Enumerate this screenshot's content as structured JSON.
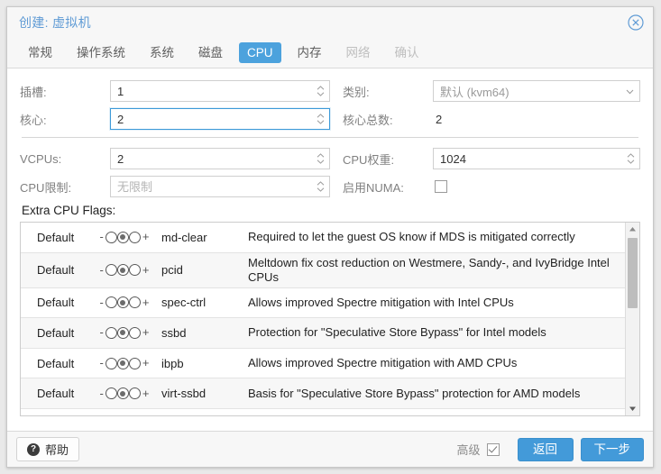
{
  "window": {
    "title": "创建: 虚拟机",
    "close_icon": "close-circle-icon"
  },
  "tabs": [
    {
      "label": "常规",
      "state": "normal"
    },
    {
      "label": "操作系统",
      "state": "normal"
    },
    {
      "label": "系统",
      "state": "normal"
    },
    {
      "label": "磁盘",
      "state": "normal"
    },
    {
      "label": "CPU",
      "state": "active"
    },
    {
      "label": "内存",
      "state": "normal"
    },
    {
      "label": "网络",
      "state": "disabled"
    },
    {
      "label": "确认",
      "state": "disabled"
    }
  ],
  "form": {
    "sockets": {
      "label": "插槽:",
      "value": "1"
    },
    "type": {
      "label": "类别:",
      "value": "默认 (kvm64)"
    },
    "cores": {
      "label": "核心:",
      "value": "2",
      "focused": true
    },
    "total_cores": {
      "label": "核心总数:",
      "value": "2"
    },
    "vcpus": {
      "label": "VCPUs:",
      "value": "2"
    },
    "cpu_weight": {
      "label": "CPU权重:",
      "value": "1024"
    },
    "cpu_limit": {
      "label": "CPU限制:",
      "value": "",
      "placeholder": "无限制"
    },
    "enable_numa": {
      "label": "启用NUMA:",
      "checked": false
    }
  },
  "flags": {
    "title": "Extra CPU Flags:",
    "minus_sign": "-",
    "plus_sign": "+",
    "rows": [
      {
        "state": "Default",
        "selected": 1,
        "name": "md-clear",
        "desc": "Required to let the guest OS know if MDS is mitigated correctly"
      },
      {
        "state": "Default",
        "selected": 1,
        "name": "pcid",
        "desc": "Meltdown fix cost reduction on Westmere, Sandy-, and IvyBridge Intel CPUs"
      },
      {
        "state": "Default",
        "selected": 1,
        "name": "spec-ctrl",
        "desc": "Allows improved Spectre mitigation with Intel CPUs"
      },
      {
        "state": "Default",
        "selected": 1,
        "name": "ssbd",
        "desc": "Protection for \"Speculative Store Bypass\" for Intel models"
      },
      {
        "state": "Default",
        "selected": 1,
        "name": "ibpb",
        "desc": "Allows improved Spectre mitigation with AMD CPUs"
      },
      {
        "state": "Default",
        "selected": 1,
        "name": "virt-ssbd",
        "desc": "Basis for \"Speculative Store Bypass\" protection for AMD models"
      }
    ]
  },
  "footer": {
    "help_label": "帮助",
    "help_icon": "question-mark-icon",
    "advanced_label": "高级",
    "advanced_checked": true,
    "back_label": "返回",
    "next_label": "下一步"
  },
  "colors": {
    "accent": "#439ad9",
    "tab_active_bg": "#4ca2dd",
    "title_text": "#5f9bd5",
    "focus_border": "#3c9ad8"
  }
}
